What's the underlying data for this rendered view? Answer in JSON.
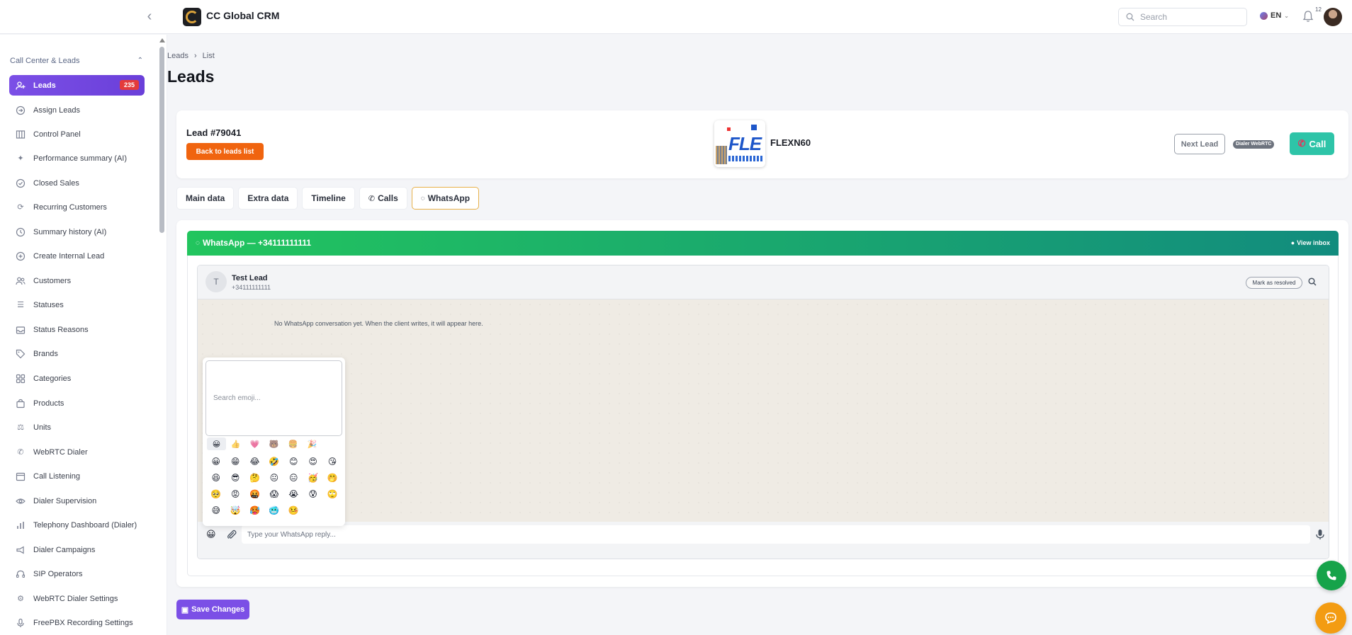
{
  "app": {
    "title": "CC Global CRM",
    "logo_icon": "cc-logo-icon"
  },
  "topbar": {
    "search_placeholder": "Search",
    "language": "EN",
    "notifications_count": "12"
  },
  "sidebar": {
    "section_title": "Call Center & Leads",
    "items": [
      {
        "label": "Leads",
        "icon": "user-plus-icon",
        "badge": "235",
        "active": true
      },
      {
        "label": "Assign Leads",
        "icon": "arrow-circle-icon"
      },
      {
        "label": "Control Panel",
        "icon": "columns-icon"
      },
      {
        "label": "Performance summary (AI)",
        "icon": "sparkles-icon"
      },
      {
        "label": "Closed Sales",
        "icon": "check-circle-icon"
      },
      {
        "label": "Recurring Customers",
        "icon": "refresh-icon"
      },
      {
        "label": "Summary history (AI)",
        "icon": "clock-icon"
      },
      {
        "label": "Create Internal Lead",
        "icon": "plus-circle-icon"
      },
      {
        "label": "Customers",
        "icon": "users-icon"
      },
      {
        "label": "Statuses",
        "icon": "list-icon"
      },
      {
        "label": "Status Reasons",
        "icon": "inbox-icon"
      },
      {
        "label": "Brands",
        "icon": "tag-icon"
      },
      {
        "label": "Categories",
        "icon": "grid-icon"
      },
      {
        "label": "Products",
        "icon": "bag-icon"
      },
      {
        "label": "Units",
        "icon": "scale-icon"
      },
      {
        "label": "WebRTC Dialer",
        "icon": "phone-icon"
      },
      {
        "label": "Call Listening",
        "icon": "calendar-icon"
      },
      {
        "label": "Dialer Supervision",
        "icon": "eye-icon"
      },
      {
        "label": "Telephony Dashboard (Dialer)",
        "icon": "bar-chart-icon"
      },
      {
        "label": "Dialer Campaigns",
        "icon": "megaphone-icon"
      },
      {
        "label": "SIP Operators",
        "icon": "headset-icon"
      },
      {
        "label": "WebRTC Dialer Settings",
        "icon": "gear-icon"
      },
      {
        "label": "FreePBX Recording Settings",
        "icon": "mic-icon"
      }
    ]
  },
  "breadcrumb": {
    "root": "Leads",
    "current": "List"
  },
  "page": {
    "title": "Leads"
  },
  "lead": {
    "id_label": "Lead #79041",
    "back_label": "Back to leads list",
    "brand_name": "FLEXN60",
    "next_label": "Next Lead",
    "dialer_badge": "Dialer WebRTC",
    "call_label": "Call"
  },
  "tabs": [
    {
      "label": "Main data"
    },
    {
      "label": "Extra data"
    },
    {
      "label": "Timeline"
    },
    {
      "label": "Calls",
      "icon": "phone-icon"
    },
    {
      "label": "WhatsApp",
      "icon": "whatsapp-icon",
      "active": true
    }
  ],
  "whatsapp": {
    "header_title": "WhatsApp — +34111111111",
    "view_inbox": "View inbox",
    "contact_initial": "T",
    "contact_name": "Test Lead",
    "contact_phone": "+34111111111",
    "mark_resolved": "Mark as resolved",
    "empty_message": "No WhatsApp conversation yet. When the client writes, it will appear here.",
    "reply_placeholder": "Type your WhatsApp reply...",
    "accent_start": "#22c55e",
    "accent_end": "#128c7e"
  },
  "emoji_picker": {
    "search_placeholder": "Search emoji...",
    "categories": [
      "😀",
      "👍",
      "💗",
      "🐻",
      "🍔",
      "🎉"
    ],
    "emojis": [
      "😀",
      "😁",
      "😂",
      "🤣",
      "😊",
      "😍",
      "😘",
      "😆",
      "😎",
      "🤔",
      "😐",
      "😑",
      "🥳",
      "🤭",
      "🥺",
      "😡",
      "🤬",
      "😱",
      "😭",
      "😰",
      "🙄",
      "😅",
      "🤯",
      "🥵",
      "🥶",
      "🤒"
    ]
  },
  "actions": {
    "save_label": "Save Changes"
  },
  "colors": {
    "primary": "#7b4fe6",
    "orange": "#f0640f",
    "call": "#2ec4a8",
    "badge": "#e43b3b"
  }
}
